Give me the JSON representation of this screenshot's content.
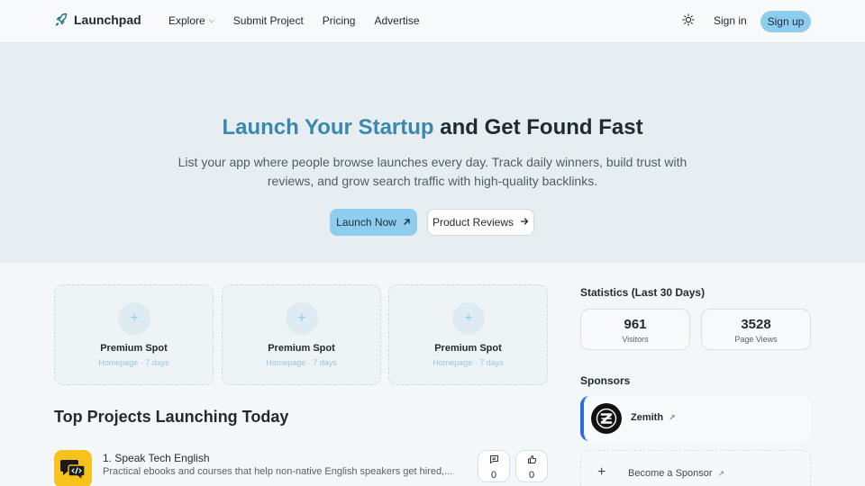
{
  "header": {
    "brand": "Launchpad",
    "nav": [
      "Explore",
      "Submit Project",
      "Pricing",
      "Advertise"
    ],
    "signin": "Sign in",
    "signup": "Sign up"
  },
  "hero": {
    "title_accent": "Launch Your Startup",
    "title_rest": " and Get Found Fast",
    "subtitle": "List your app where people browse launches every day. Track daily winners, build trust with reviews, and grow search traffic with high-quality backlinks.",
    "primary_cta": "Launch Now",
    "secondary_cta": "Product Reviews"
  },
  "premium_spots": [
    {
      "title": "Premium Spot",
      "sub": "Homepage · 7 days"
    },
    {
      "title": "Premium Spot",
      "sub": "Homepage · 7 days"
    },
    {
      "title": "Premium Spot",
      "sub": "Homepage · 7 days"
    }
  ],
  "top_projects": {
    "title": "Top Projects Launching Today",
    "items": [
      {
        "name": "1. Speak Tech English",
        "desc": "Practical ebooks and courses that help non-native English speakers get hired,...",
        "comments": "0",
        "upvotes": "0"
      }
    ]
  },
  "sidebar": {
    "stats_title": "Statistics (Last 30 Days)",
    "stats": [
      {
        "value": "961",
        "label": "Visitors"
      },
      {
        "value": "3528",
        "label": "Page Views"
      }
    ],
    "sponsors_title": "Sponsors",
    "sponsor_name": "Zemith",
    "become_sponsor": "Become a Sponsor"
  },
  "colors": {
    "accent": "#3a88ad",
    "button": "#8fcdee",
    "sponsor_bar": "#2f6ae0"
  },
  "icons": [
    "rocket-icon",
    "chevron-down-icon",
    "sun-icon",
    "arrow-up-right-icon",
    "arrow-right-icon",
    "plus-icon",
    "comment-icon",
    "thumbs-up-icon"
  ]
}
